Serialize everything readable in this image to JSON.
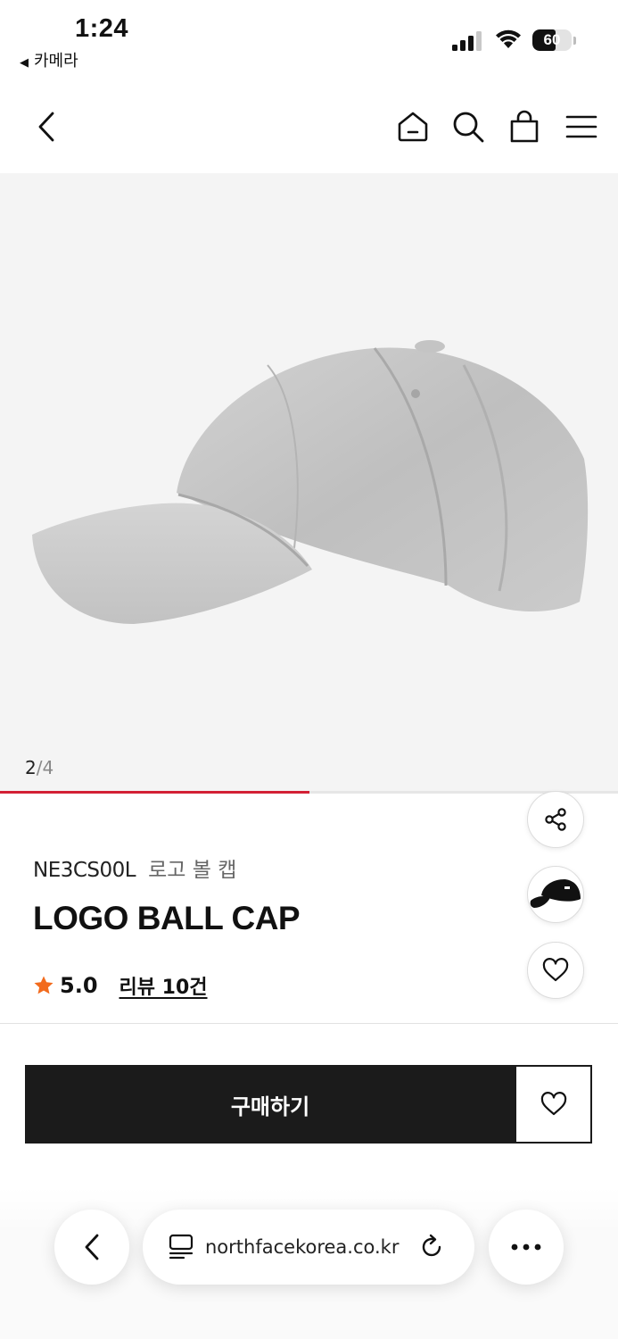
{
  "status_bar": {
    "time": "1:24",
    "back_app": "카메라",
    "battery": "60",
    "battery_level": 0.6
  },
  "nav": {
    "icons": [
      "back-chevron-icon",
      "home-icon",
      "search-icon",
      "shopping-bag-icon",
      "menu-icon"
    ]
  },
  "gallery": {
    "current": "2",
    "total": "/4",
    "progress": 0.5,
    "background": "#f4f4f4"
  },
  "product": {
    "code": "NE3CS00L",
    "korean_name": "로고 볼 캡",
    "name": "LOGO BALL CAP",
    "rating": "5.0",
    "reviews": "리뷰 10건"
  },
  "actions": {
    "buy_label": "구매하기"
  },
  "browser": {
    "url": "northfacekorea.co.kr"
  },
  "colors": {
    "accent": "#d32035",
    "star": "#f26b1d",
    "button": "#1b1b1b"
  }
}
